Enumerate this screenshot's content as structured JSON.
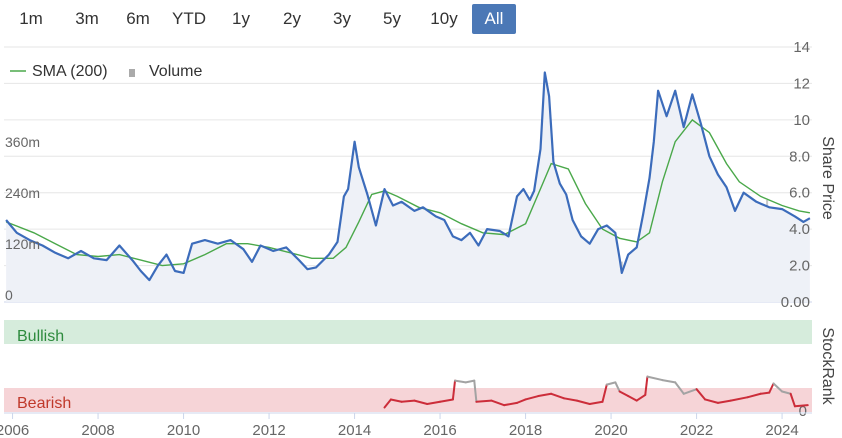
{
  "range_buttons": [
    {
      "label": "1m",
      "active": false
    },
    {
      "label": "3m",
      "active": false
    },
    {
      "label": "6m",
      "active": false
    },
    {
      "label": "YTD",
      "active": false
    },
    {
      "label": "1y",
      "active": false
    },
    {
      "label": "2y",
      "active": false
    },
    {
      "label": "3y",
      "active": false
    },
    {
      "label": "5y",
      "active": false
    },
    {
      "label": "10y",
      "active": false
    },
    {
      "label": "All",
      "active": true
    }
  ],
  "legend": {
    "sma_label": "SMA (200)",
    "volume_label": "Volume"
  },
  "colors": {
    "price": "#3c6cbb",
    "sma": "#4aa84a",
    "volume": "#c8c8c8",
    "bullish_band": "#d6ecdc",
    "bearish_band": "#f6d4d7",
    "bullish_text": "#2e8b3e",
    "bearish_text": "#c0392b",
    "rank_red": "#cc2d3a",
    "rank_gray": "#a3a3a3",
    "active_button": "#4b78b6"
  },
  "chart_data": {
    "type": "line",
    "x_label": "",
    "y_right_title": "Share Price",
    "y_left_title": "",
    "x_ticks": [
      "2006",
      "2008",
      "2010",
      "2012",
      "2014",
      "2016",
      "2018",
      "2020",
      "2022",
      "2024"
    ],
    "xlim": [
      2005.8,
      2024.7
    ],
    "price_ticks": [
      "0.00",
      "2.0",
      "4.0",
      "6.0",
      "8.0",
      "10",
      "12",
      "14"
    ],
    "price_ylim": [
      0,
      14
    ],
    "volume_ticks": [
      "0",
      "120m",
      "240m",
      "360m"
    ],
    "volume_ylim": [
      0,
      600
    ],
    "series": [
      {
        "name": "Share Price",
        "points": [
          [
            2005.85,
            4.5
          ],
          [
            2006.1,
            3.8
          ],
          [
            2006.4,
            3.4
          ],
          [
            2006.7,
            3.1
          ],
          [
            2007.0,
            2.7
          ],
          [
            2007.3,
            2.4
          ],
          [
            2007.6,
            2.8
          ],
          [
            2007.9,
            2.4
          ],
          [
            2008.2,
            2.3
          ],
          [
            2008.5,
            3.1
          ],
          [
            2008.8,
            2.3
          ],
          [
            2009.0,
            1.7
          ],
          [
            2009.2,
            1.2
          ],
          [
            2009.4,
            2.0
          ],
          [
            2009.6,
            2.6
          ],
          [
            2009.8,
            1.7
          ],
          [
            2010.0,
            1.6
          ],
          [
            2010.2,
            3.2
          ],
          [
            2010.5,
            3.4
          ],
          [
            2010.8,
            3.2
          ],
          [
            2011.1,
            3.4
          ],
          [
            2011.4,
            2.9
          ],
          [
            2011.6,
            2.2
          ],
          [
            2011.8,
            3.1
          ],
          [
            2012.1,
            2.8
          ],
          [
            2012.4,
            3.0
          ],
          [
            2012.7,
            2.3
          ],
          [
            2012.9,
            1.8
          ],
          [
            2013.1,
            1.9
          ],
          [
            2013.4,
            2.6
          ],
          [
            2013.6,
            3.3
          ],
          [
            2013.75,
            5.8
          ],
          [
            2013.85,
            6.2
          ],
          [
            2014.0,
            8.8
          ],
          [
            2014.1,
            7.4
          ],
          [
            2014.3,
            5.9
          ],
          [
            2014.5,
            4.2
          ],
          [
            2014.7,
            6.2
          ],
          [
            2014.9,
            5.3
          ],
          [
            2015.1,
            5.5
          ],
          [
            2015.4,
            5.0
          ],
          [
            2015.6,
            5.2
          ],
          [
            2015.9,
            4.7
          ],
          [
            2016.1,
            4.5
          ],
          [
            2016.3,
            3.6
          ],
          [
            2016.5,
            3.4
          ],
          [
            2016.7,
            3.8
          ],
          [
            2016.9,
            3.1
          ],
          [
            2017.1,
            4.0
          ],
          [
            2017.4,
            3.9
          ],
          [
            2017.6,
            3.6
          ],
          [
            2017.8,
            5.8
          ],
          [
            2017.95,
            6.2
          ],
          [
            2018.1,
            5.6
          ],
          [
            2018.2,
            6.1
          ],
          [
            2018.35,
            8.4
          ],
          [
            2018.45,
            12.6
          ],
          [
            2018.55,
            11.3
          ],
          [
            2018.65,
            7.7
          ],
          [
            2018.8,
            6.5
          ],
          [
            2018.95,
            5.9
          ],
          [
            2019.1,
            4.5
          ],
          [
            2019.3,
            3.6
          ],
          [
            2019.5,
            3.2
          ],
          [
            2019.7,
            4.0
          ],
          [
            2019.9,
            4.2
          ],
          [
            2020.1,
            3.8
          ],
          [
            2020.2,
            2.4
          ],
          [
            2020.25,
            1.6
          ],
          [
            2020.4,
            2.6
          ],
          [
            2020.6,
            3.0
          ],
          [
            2020.75,
            4.8
          ],
          [
            2020.9,
            6.8
          ],
          [
            2021.0,
            8.8
          ],
          [
            2021.1,
            11.6
          ],
          [
            2021.3,
            10.2
          ],
          [
            2021.5,
            11.6
          ],
          [
            2021.7,
            9.6
          ],
          [
            2021.9,
            11.4
          ],
          [
            2022.1,
            9.8
          ],
          [
            2022.3,
            8.0
          ],
          [
            2022.5,
            7.0
          ],
          [
            2022.7,
            6.3
          ],
          [
            2022.9,
            5.0
          ],
          [
            2023.1,
            6.0
          ],
          [
            2023.4,
            5.5
          ],
          [
            2023.7,
            5.2
          ],
          [
            2024.0,
            5.1
          ],
          [
            2024.3,
            4.7
          ],
          [
            2024.5,
            4.4
          ],
          [
            2024.65,
            4.6
          ]
        ]
      },
      {
        "name": "SMA (200)",
        "points": [
          [
            2005.85,
            4.4
          ],
          [
            2006.5,
            3.8
          ],
          [
            2007.0,
            3.2
          ],
          [
            2007.5,
            2.6
          ],
          [
            2008.0,
            2.5
          ],
          [
            2008.5,
            2.6
          ],
          [
            2009.0,
            2.3
          ],
          [
            2009.5,
            2.0
          ],
          [
            2010.0,
            2.1
          ],
          [
            2010.5,
            2.6
          ],
          [
            2011.0,
            3.2
          ],
          [
            2011.5,
            3.2
          ],
          [
            2012.0,
            3.0
          ],
          [
            2012.5,
            2.7
          ],
          [
            2013.0,
            2.4
          ],
          [
            2013.5,
            2.4
          ],
          [
            2013.8,
            3.0
          ],
          [
            2014.1,
            4.4
          ],
          [
            2014.4,
            5.9
          ],
          [
            2014.7,
            6.1
          ],
          [
            2015.0,
            5.8
          ],
          [
            2015.5,
            5.2
          ],
          [
            2016.0,
            4.9
          ],
          [
            2016.5,
            4.3
          ],
          [
            2017.0,
            3.8
          ],
          [
            2017.5,
            3.7
          ],
          [
            2018.0,
            4.3
          ],
          [
            2018.4,
            6.5
          ],
          [
            2018.6,
            7.6
          ],
          [
            2019.0,
            7.3
          ],
          [
            2019.4,
            5.4
          ],
          [
            2019.8,
            4.0
          ],
          [
            2020.2,
            3.5
          ],
          [
            2020.6,
            3.3
          ],
          [
            2020.9,
            3.8
          ],
          [
            2021.2,
            6.6
          ],
          [
            2021.5,
            8.8
          ],
          [
            2021.9,
            10.0
          ],
          [
            2022.3,
            9.3
          ],
          [
            2022.7,
            7.6
          ],
          [
            2023.0,
            6.6
          ],
          [
            2023.5,
            5.8
          ],
          [
            2024.0,
            5.3
          ],
          [
            2024.4,
            5.0
          ],
          [
            2024.65,
            4.9
          ]
        ]
      }
    ],
    "volume": [
      [
        2013.7,
        10
      ],
      [
        2014.2,
        45
      ],
      [
        2014.4,
        20
      ],
      [
        2014.7,
        15
      ],
      [
        2015.0,
        12
      ],
      [
        2015.5,
        10
      ],
      [
        2016.0,
        18
      ],
      [
        2016.4,
        30
      ],
      [
        2016.8,
        15
      ],
      [
        2017.2,
        12
      ],
      [
        2017.6,
        20
      ],
      [
        2017.85,
        95
      ],
      [
        2017.95,
        70
      ],
      [
        2018.1,
        40
      ],
      [
        2018.35,
        85
      ],
      [
        2018.45,
        110
      ],
      [
        2018.55,
        60
      ],
      [
        2018.8,
        40
      ],
      [
        2019.1,
        25
      ],
      [
        2019.5,
        30
      ],
      [
        2019.9,
        20
      ],
      [
        2020.25,
        95
      ],
      [
        2020.45,
        45
      ],
      [
        2020.75,
        50
      ],
      [
        2020.95,
        110
      ],
      [
        2021.05,
        250
      ],
      [
        2021.2,
        80
      ],
      [
        2021.45,
        100
      ],
      [
        2021.7,
        60
      ],
      [
        2022.0,
        40
      ],
      [
        2022.4,
        30
      ],
      [
        2022.7,
        25
      ],
      [
        2023.0,
        30
      ],
      [
        2023.4,
        25
      ],
      [
        2023.65,
        240
      ],
      [
        2023.8,
        40
      ],
      [
        2024.1,
        25
      ],
      [
        2024.4,
        15
      ]
    ],
    "stockrank_ylim": [
      0,
      100
    ],
    "stockrank_ticks": [
      "0"
    ],
    "stockrank_title": "StockRank",
    "bullish_label": "Bullish",
    "bearish_label": "Bearish",
    "stockrank": [
      [
        2014.7,
        8
      ],
      [
        2014.85,
        22
      ],
      [
        2015.1,
        18
      ],
      [
        2015.4,
        20
      ],
      [
        2015.7,
        14
      ],
      [
        2016.0,
        18
      ],
      [
        2016.3,
        22
      ],
      [
        2016.35,
        55
      ],
      [
        2016.6,
        52
      ],
      [
        2016.8,
        55
      ],
      [
        2016.85,
        18
      ],
      [
        2017.2,
        20
      ],
      [
        2017.5,
        12
      ],
      [
        2017.8,
        16
      ],
      [
        2018.0,
        22
      ],
      [
        2018.3,
        28
      ],
      [
        2018.6,
        32
      ],
      [
        2018.9,
        24
      ],
      [
        2019.2,
        20
      ],
      [
        2019.5,
        14
      ],
      [
        2019.8,
        18
      ],
      [
        2019.9,
        48
      ],
      [
        2020.1,
        52
      ],
      [
        2020.2,
        36
      ],
      [
        2020.4,
        28
      ],
      [
        2020.6,
        20
      ],
      [
        2020.8,
        30
      ],
      [
        2020.85,
        62
      ],
      [
        2021.2,
        56
      ],
      [
        2021.5,
        52
      ],
      [
        2021.7,
        32
      ],
      [
        2022.0,
        40
      ],
      [
        2022.2,
        22
      ],
      [
        2022.5,
        16
      ],
      [
        2022.8,
        20
      ],
      [
        2023.2,
        26
      ],
      [
        2023.5,
        32
      ],
      [
        2023.7,
        34
      ],
      [
        2023.8,
        50
      ],
      [
        2024.0,
        36
      ],
      [
        2024.2,
        32
      ],
      [
        2024.3,
        10
      ],
      [
        2024.6,
        12
      ]
    ],
    "stockrank_gray_ranges": [
      [
        2016.35,
        2016.85
      ],
      [
        2019.9,
        2020.2
      ],
      [
        2020.85,
        2022.0
      ],
      [
        2023.8,
        2024.2
      ]
    ]
  }
}
